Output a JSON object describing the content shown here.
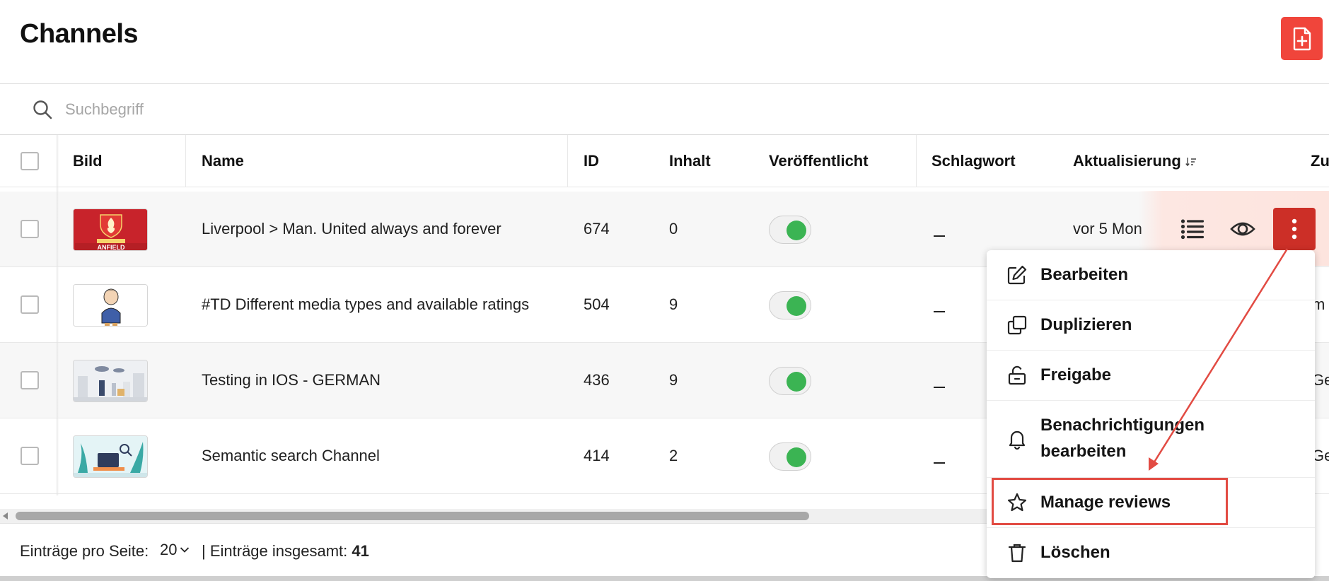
{
  "header": {
    "title": "Channels",
    "add_button_icon": "add-file-icon",
    "accent_color": "#f0453b"
  },
  "search": {
    "placeholder": "Suchbegriff",
    "value": ""
  },
  "table": {
    "columns": [
      "Bild",
      "Name",
      "ID",
      "Inhalt",
      "Veröffentlicht",
      "Schlagwort",
      "Aktualisierung",
      "Zu"
    ],
    "sort_column": "Aktualisierung",
    "rows": [
      {
        "name": "Liverpool > Man. United always and forever",
        "id": "674",
        "content": "0",
        "published": true,
        "tag": "_",
        "updated": "vor 5 Mon",
        "extra": "",
        "thumb_text": "ANFIELD"
      },
      {
        "name": "#TD Different media types and available ratings",
        "id": "504",
        "content": "9",
        "published": true,
        "tag": "_",
        "updated": "",
        "extra": "m"
      },
      {
        "name": "Testing in IOS - GERMAN",
        "id": "436",
        "content": "9",
        "published": true,
        "tag": "_",
        "updated": "",
        "extra": "Ge"
      },
      {
        "name": "Semantic search Channel",
        "id": "414",
        "content": "2",
        "published": true,
        "tag": "_",
        "updated": "",
        "extra": "Ge"
      }
    ]
  },
  "row_actions": {
    "icons": [
      "list-icon",
      "eye-icon",
      "more-vertical-icon"
    ],
    "active_color": "#cc2f27"
  },
  "menu": {
    "items": [
      {
        "label": "Bearbeiten",
        "icon": "edit-icon"
      },
      {
        "label": "Duplizieren",
        "icon": "duplicate-icon"
      },
      {
        "label": "Freigabe",
        "icon": "unlock-icon"
      },
      {
        "label": "Benachrichtigungen",
        "label2": "bearbeiten",
        "icon": "bell-icon"
      },
      {
        "label": "Manage reviews",
        "icon": "star-icon"
      },
      {
        "label": "Löschen",
        "icon": "trash-icon"
      }
    ]
  },
  "footer": {
    "per_page_label": "Einträge pro Seite:",
    "per_page_value": "20",
    "total_label": "| Einträge insgesamt:",
    "total_value": "41"
  },
  "annotation": {
    "highlight_color": "#e24b43"
  }
}
